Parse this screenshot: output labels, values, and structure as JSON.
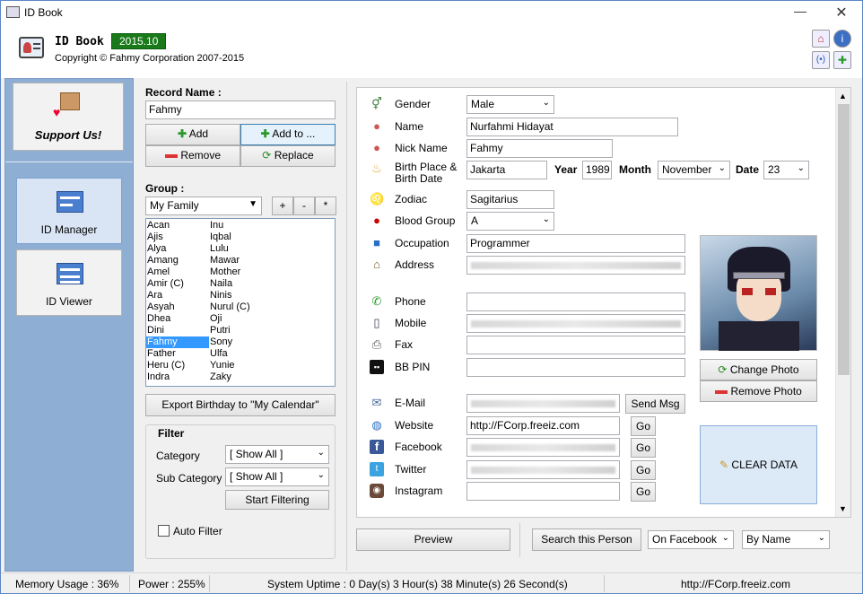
{
  "window": {
    "title": "ID Book",
    "controls": [
      "—",
      "✕"
    ]
  },
  "header": {
    "app_name": "ID Book",
    "version": "2015.10",
    "copyright": "Copyright © Fahmy Corporation 2007-2015",
    "buttons": [
      "home-icon",
      "info-icon",
      "sync-icon",
      "add-icon"
    ]
  },
  "sidebar": {
    "support": "Support Us!",
    "items": [
      {
        "label": "ID Manager"
      },
      {
        "label": "ID Viewer"
      }
    ]
  },
  "record": {
    "label": "Record Name :",
    "value": "Fahmy",
    "add": "Add",
    "add_to": "Add to ...",
    "remove": "Remove",
    "replace": "Replace"
  },
  "group": {
    "label": "Group :",
    "value": "My Family",
    "plus": "+",
    "minus": "-",
    "star": "*"
  },
  "names_col1": [
    "Acan",
    "Ajis",
    "Alya",
    "Amang",
    "Amel",
    "Amir (C)",
    "Ara",
    "Asyah",
    "Dhea",
    "Dini",
    "Fahmy",
    "Father",
    "Heru (C)",
    "Indra"
  ],
  "names_col2": [
    "Inu",
    "Iqbal",
    "Lulu",
    "Mawar",
    "Mother",
    "Naila",
    "Ninis",
    "Nurul (C)",
    "Oji",
    "Putri",
    "Sony",
    "Ulfa",
    "Yunie",
    "Zaky"
  ],
  "selected_name": "Fahmy",
  "export_label": "Export Birthday to \"My Calendar\"",
  "filter": {
    "title": "Filter",
    "category_label": "Category",
    "category_value": "[ Show All ]",
    "subcat_label": "Sub Category",
    "subcat_value": "[ Show All ]",
    "start": "Start Filtering",
    "auto": "Auto Filter"
  },
  "form": {
    "gender": {
      "label": "Gender",
      "value": "Male"
    },
    "name": {
      "label": "Name",
      "value": "Nurfahmi Hidayat"
    },
    "nick": {
      "label": "Nick Name",
      "value": "Fahmy"
    },
    "birth": {
      "label1": "Birth Place &",
      "label2": "Birth Date",
      "place": "Jakarta",
      "year_label": "Year",
      "year": "1989",
      "month_label": "Month",
      "month": "November",
      "date_label": "Date",
      "date": "23"
    },
    "zodiac": {
      "label": "Zodiac",
      "value": "Sagitarius"
    },
    "blood": {
      "label": "Blood Group",
      "value": "A"
    },
    "occupation": {
      "label": "Occupation",
      "value": "Programmer"
    },
    "address": {
      "label": "Address"
    },
    "phone": {
      "label": "Phone"
    },
    "mobile": {
      "label": "Mobile"
    },
    "fax": {
      "label": "Fax"
    },
    "bbpin": {
      "label": "BB PIN"
    },
    "email": {
      "label": "E-Mail",
      "send": "Send Msg"
    },
    "website": {
      "label": "Website",
      "value": "http://FCorp.freeiz.com",
      "go": "Go"
    },
    "facebook": {
      "label": "Facebook",
      "go": "Go"
    },
    "twitter": {
      "label": "Twitter",
      "go": "Go"
    },
    "instagram": {
      "label": "Instagram",
      "go": "Go"
    },
    "change_photo": "Change Photo",
    "remove_photo": "Remove Photo",
    "clear": "CLEAR DATA"
  },
  "bottom": {
    "preview": "Preview",
    "search": "Search this Person",
    "on": "On Facebook",
    "by": "By Name"
  },
  "status": {
    "memory": "Memory Usage : 36%",
    "power": "Power : 255%",
    "uptime": "System Uptime : 0 Day(s) 3 Hour(s) 38 Minute(s) 26 Second(s)",
    "url": "http://FCorp.freeiz.com"
  }
}
